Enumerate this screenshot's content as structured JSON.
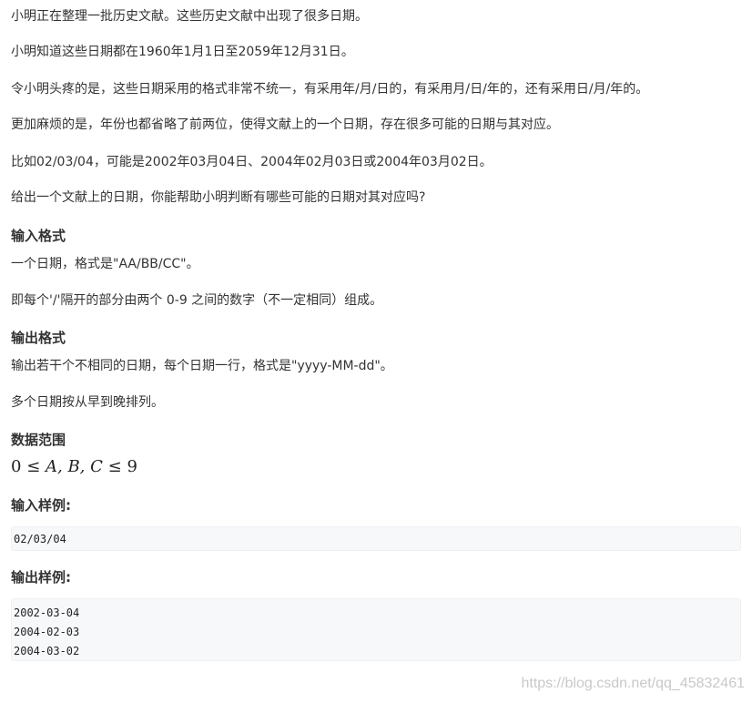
{
  "description": {
    "p1": "小明正在整理一批历史文献。这些历史文献中出现了很多日期。",
    "p2": "小明知道这些日期都在1960年1月1日至2059年12月31日。",
    "p3": "令小明头疼的是，这些日期采用的格式非常不统一，有采用年/月/日的，有采用月/日/年的，还有采用日/月/年的。",
    "p4": "更加麻烦的是，年份也都省略了前两位，使得文献上的一个日期，存在很多可能的日期与其对应。",
    "p5": "比如02/03/04，可能是2002年03月04日、2004年02月03日或2004年03月02日。",
    "p6": "给出一个文献上的日期，你能帮助小明判断有哪些可能的日期对其对应吗?"
  },
  "input_format": {
    "heading": "输入格式",
    "line1": "一个日期，格式是\"AA/BB/CC\"。",
    "line2": "即每个'/'隔开的部分由两个 0-9 之间的数字（不一定相同）组成。"
  },
  "output_format": {
    "heading": "输出格式",
    "line1": "输出若干个不相同的日期，每个日期一行，格式是\"yyyy-MM-dd\"。",
    "line2": "多个日期按从早到晚排列。"
  },
  "range": {
    "heading": "数据范围",
    "math": {
      "lower": "0",
      "le1": "≤",
      "vars": "A, B, C",
      "le2": "≤",
      "upper": "9"
    }
  },
  "sample_input": {
    "heading": "输入样例:",
    "lines": [
      "02/03/04"
    ]
  },
  "sample_output": {
    "heading": "输出样例:",
    "lines": [
      "2002-03-04",
      "2004-02-03",
      "2004-03-02"
    ]
  },
  "watermark": "https://blog.csdn.net/qq_45832461"
}
